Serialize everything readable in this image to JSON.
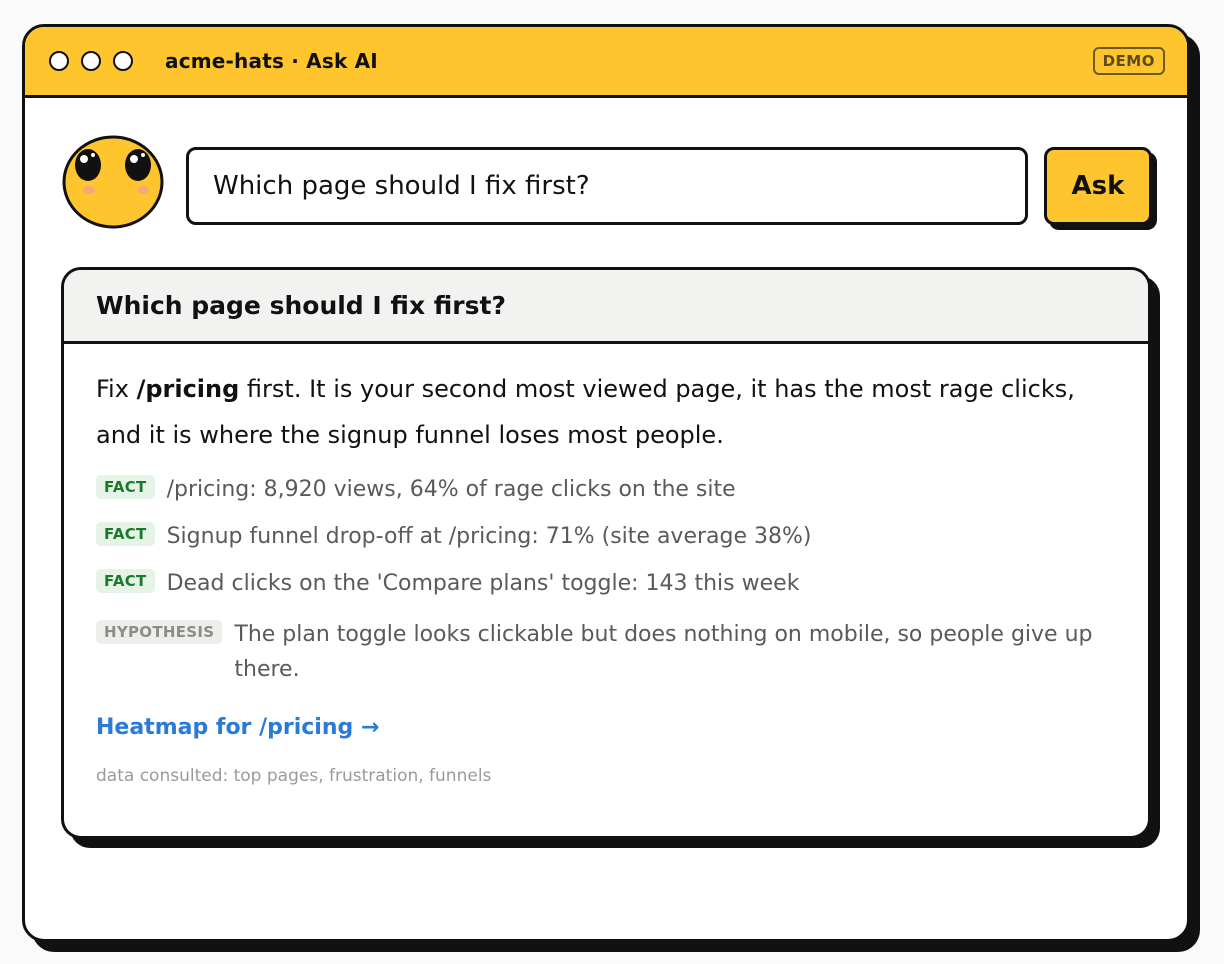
{
  "window": {
    "title": "acme-hats · Ask AI",
    "badge": "DEMO",
    "controls": [
      "close-dot",
      "minimize-dot",
      "maximize-dot"
    ]
  },
  "ask": {
    "avatar_icon": "smiley-face-icon",
    "input_value": "Which page should I fix first?",
    "button_label": "Ask"
  },
  "answer": {
    "question": "Which page should I fix first?",
    "summary_prefix": "Fix ",
    "summary_strong": "/pricing",
    "summary_rest": " first. It is your second most viewed page, it has the most rage clicks, and it is where the signup funnel loses most people.",
    "claims": [
      {
        "tag": "FACT",
        "text": "/pricing: 8,920 views, 64% of rage clicks on the site"
      },
      {
        "tag": "FACT",
        "text": "Signup funnel drop-off at /pricing: 71% (site average 38%)"
      },
      {
        "tag": "FACT",
        "text": "Dead clicks on the 'Compare plans' toggle: 143 this week"
      },
      {
        "tag": "HYPOTHESIS",
        "text": "The plan toggle looks clickable but does nothing on mobile, so people give up there."
      }
    ],
    "link_label": "Heatmap for /pricing →",
    "footer": "data consulted: top pages, frustration, funnels"
  },
  "colors": {
    "accent_yellow": "#fec52e",
    "fact_green": "#1b7a2a",
    "link_blue": "#2a7ad6"
  }
}
